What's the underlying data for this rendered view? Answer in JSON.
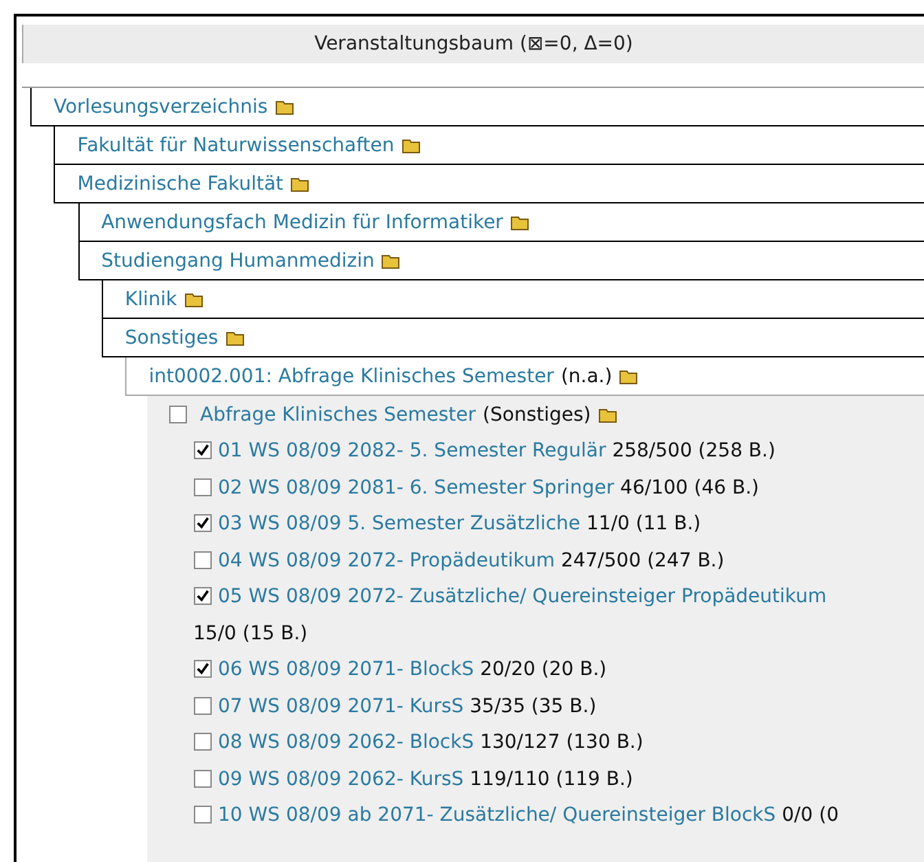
{
  "title": "Veranstaltungsbaum (⊠=0, Δ=0)",
  "tree": [
    {
      "label": "Vorlesungsverzeichnis",
      "children": [
        {
          "label": "Fakultät für Naturwissenschaften"
        },
        {
          "label": "Medizinische Fakultät",
          "children": [
            {
              "label": "Anwendungsfach Medizin für Informatiker"
            },
            {
              "label": "Studiengang Humanmedizin",
              "children": [
                {
                  "label": "Klinik"
                },
                {
                  "label": "Sonstiges",
                  "children": [
                    {
                      "label": "int0002.001: Abfrage Klinisches Semester",
                      "note": "(n.a.)",
                      "children": [
                        {
                          "kind": "group",
                          "label": "Abfrage Klinisches Semester",
                          "note": "(Sonstiges)",
                          "checked": false,
                          "items": [
                            {
                              "label": "01 WS 08/09 2082- 5. Semester Regulär",
                              "count": "258/500 (258 B.)",
                              "checked": true
                            },
                            {
                              "label": "02 WS 08/09 2081- 6. Semester Springer",
                              "count": "46/100 (46 B.)",
                              "checked": false
                            },
                            {
                              "label": "03 WS 08/09 5. Semester Zusätzliche",
                              "count": "11/0 (11 B.)",
                              "checked": true
                            },
                            {
                              "label": "04 WS 08/09 2072- Propädeutikum",
                              "count": "247/500 (247 B.)",
                              "checked": false
                            },
                            {
                              "label": "05 WS 08/09 2072- Zusätzliche/ Quereinsteiger Propädeutikum",
                              "count": "15/0 (15 B.)",
                              "checked": true
                            },
                            {
                              "label": "06 WS 08/09 2071- BlockS",
                              "count": "20/20 (20 B.)",
                              "checked": true
                            },
                            {
                              "label": "07 WS 08/09 2071- KursS",
                              "count": "35/35 (35 B.)",
                              "checked": false
                            },
                            {
                              "label": "08 WS 08/09 2062- BlockS",
                              "count": "130/127 (130 B.)",
                              "checked": false
                            },
                            {
                              "label": "09 WS 08/09 2062- KursS",
                              "count": "119/110 (119 B.)",
                              "checked": false
                            },
                            {
                              "label": "10 WS 08/09 ab 2071- Zusätzliche/ Quereinsteiger BlockS",
                              "count": "0/0 (0",
                              "checked": false
                            }
                          ]
                        }
                      ]
                    }
                  ]
                }
              ]
            }
          ]
        }
      ]
    }
  ]
}
